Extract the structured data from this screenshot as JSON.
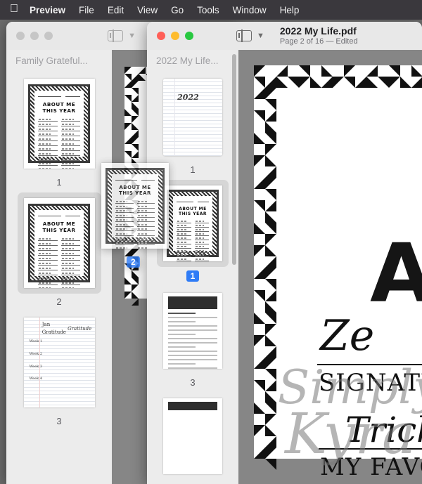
{
  "menubar": {
    "apple_icon": "apple-logo",
    "items": [
      {
        "label": "Preview",
        "bold": true
      },
      {
        "label": "File"
      },
      {
        "label": "Edit"
      },
      {
        "label": "View"
      },
      {
        "label": "Go"
      },
      {
        "label": "Tools"
      },
      {
        "label": "Window"
      },
      {
        "label": "Help"
      }
    ]
  },
  "back_window": {
    "state": "inactive",
    "sidebar": {
      "header": "Family Grateful...",
      "thumbnails": [
        {
          "page_label": "1",
          "kind": "about-me-certificate",
          "selected": false
        },
        {
          "page_label": "2",
          "kind": "about-me-certificate",
          "selected": true
        },
        {
          "page_label": "3",
          "kind": "handwritten-lined",
          "selected": false
        }
      ]
    },
    "toolbar": {
      "sidebar_toggle_icon": "sidebar-panel-icon",
      "chevron_icon": "chevron-down-icon"
    }
  },
  "front_window": {
    "state": "active",
    "toolbar": {
      "sidebar_toggle_icon": "sidebar-panel-icon",
      "chevron_icon": "chevron-down-icon",
      "title": "2022 My Life.pdf",
      "subtitle": "Page 2 of 16 — Edited"
    },
    "sidebar": {
      "header": "2022 My Life...",
      "thumbnails": [
        {
          "page_label": "1",
          "kind": "lined-2022",
          "selected": false,
          "badge": false
        },
        {
          "page_label": "1",
          "kind": "about-me-certificate",
          "selected": true,
          "badge": true
        },
        {
          "page_label": "3",
          "kind": "reflect-worksheet",
          "selected": false,
          "badge": false
        }
      ]
    },
    "document_view": {
      "page_letter": "A",
      "script_word": "Ze",
      "cap_word_1": "SIGNATURE",
      "script_word_2": "Trick",
      "cap_word_2": "MY FAVORIT",
      "watermark_line_1": "Simply",
      "watermark_line_2": "Kyra",
      "border_pattern": "black-white-triangles"
    }
  },
  "drag_operation": {
    "ghost_page_kind": "about-me-certificate",
    "badge_count": "2"
  },
  "colors": {
    "menubar_bg": "#3a383d",
    "desktop_bg": "#6d6d6d",
    "window_chrome": "#ececec",
    "content_bg": "#868686",
    "selection_blue": "#2f7cf6",
    "inactive_selection": "#d6d6d6",
    "traffic_red": "#ff5f57",
    "traffic_yellow": "#febc2e",
    "traffic_green": "#28c840"
  }
}
